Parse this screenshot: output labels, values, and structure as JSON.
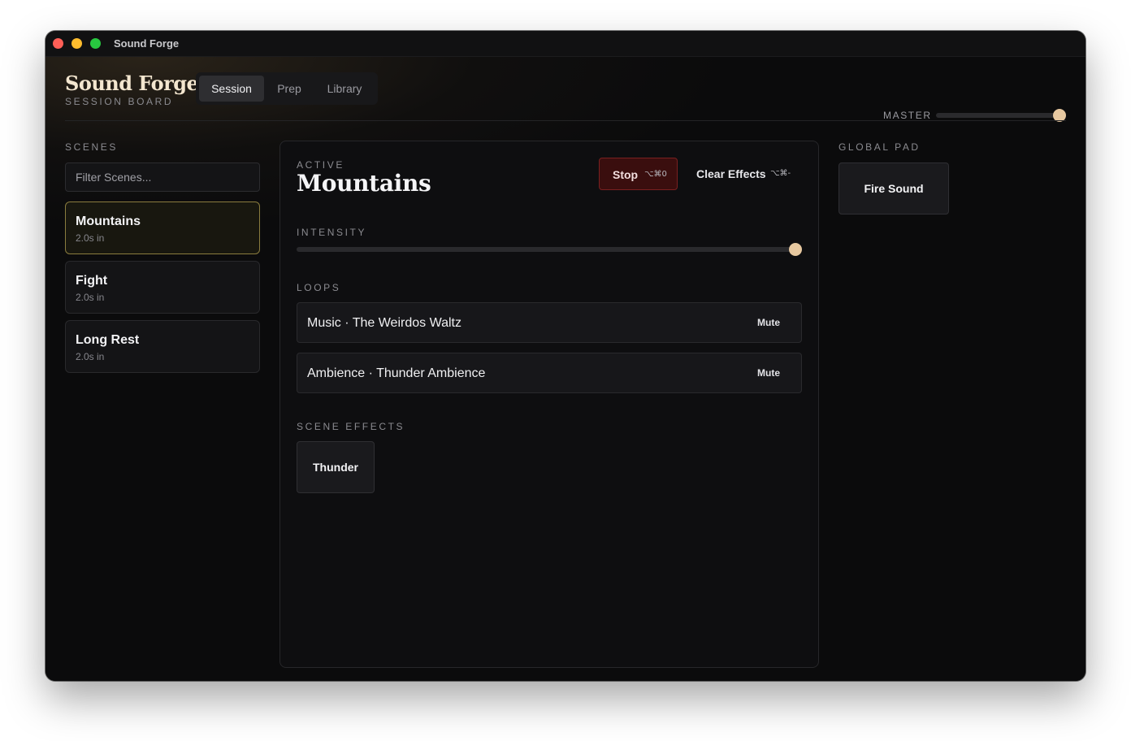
{
  "window": {
    "title": "Sound Forge"
  },
  "brand": {
    "title": "Sound Forge",
    "subtitle": "SESSION BOARD"
  },
  "tabs": [
    {
      "label": "Session",
      "active": true
    },
    {
      "label": "Prep",
      "active": false
    },
    {
      "label": "Library",
      "active": false
    }
  ],
  "master": {
    "label": "MASTER",
    "value": 1.0
  },
  "scenes": {
    "label": "SCENES",
    "filter_placeholder": "Filter Scenes...",
    "items": [
      {
        "name": "Mountains",
        "meta": "2.0s in",
        "selected": true
      },
      {
        "name": "Fight",
        "meta": "2.0s in",
        "selected": false
      },
      {
        "name": "Long Rest",
        "meta": "2.0s in",
        "selected": false
      }
    ]
  },
  "active": {
    "label": "ACTIVE",
    "title": "Mountains",
    "stop": {
      "label": "Stop",
      "shortcut": "⌥⌘0"
    },
    "clear": {
      "label": "Clear Effects",
      "shortcut": "⌥⌘-"
    },
    "intensity": {
      "label": "INTENSITY",
      "value": 1.0
    },
    "loops": {
      "label": "LOOPS",
      "items": [
        {
          "label": "Music · The Weirdos Waltz",
          "action": "Mute"
        },
        {
          "label": "Ambience · Thunder Ambience",
          "action": "Mute"
        }
      ]
    },
    "effects": {
      "label": "SCENE EFFECTS",
      "items": [
        "Thunder"
      ]
    }
  },
  "global_pad": {
    "label": "GLOBAL PAD",
    "items": [
      "Fire Sound"
    ]
  },
  "colors": {
    "accent_knob": "#e7c8a0",
    "stop_bg": "#3a0e0e",
    "selected_border": "#8a7c3e",
    "brand_text": "#f3e6cf"
  }
}
